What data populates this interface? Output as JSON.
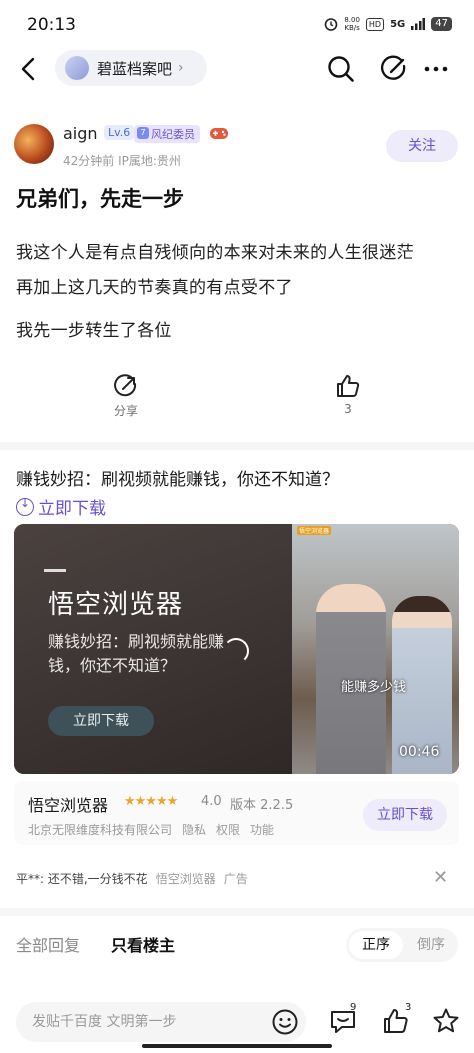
{
  "status": {
    "time": "20:13",
    "net_speed": "8.00\nKB/s",
    "hd": "HD",
    "signal": "5G",
    "battery": "47"
  },
  "topbar": {
    "forum_name": "碧蓝档案吧"
  },
  "author": {
    "name": "aign",
    "level": "Lv.6",
    "badge_num": "7",
    "badge": "风纪委员",
    "meta": "42分钟前  IP属地:贵州",
    "follow": "关注"
  },
  "post": {
    "title": "兄弟们，先走一步",
    "lines": [
      "我这个人是有点自残倾向的本来对未来的人生很迷茫",
      "再加上这几天的节奏真的有点受不了",
      "我先一步转生了各位"
    ]
  },
  "actions": {
    "share": "分享",
    "likes": "3"
  },
  "ad": {
    "headline": "赚钱妙招：刷视频就能赚钱，你还不知道？",
    "download_link": "立即下载",
    "video": {
      "brand": "悟空浏览器",
      "sub1": "赚钱妙招：刷视频就能赚",
      "sub2": "钱，你还不知道？",
      "button": "立即下载",
      "caption": "能赚多少钱",
      "duration": "00:46",
      "tag": "悟空浏览器"
    },
    "app": {
      "name": "悟空浏览器",
      "stars": "★★★★★",
      "rating": "4.0",
      "version": "版本 2.2.5",
      "company": "北京无限维度科技有限公司",
      "privacy": "隐私",
      "permissions": "权限",
      "features": "功能",
      "download": "立即下载"
    },
    "comment": "平**: 还不错,一分钱不花",
    "app_label": "悟空浏览器",
    "ad_label": "广告"
  },
  "replies": {
    "all": "全部回复",
    "only_op": "只看楼主",
    "sort_asc": "正序",
    "sort_desc": "倒序"
  },
  "bottombar": {
    "placeholder": "发贴千百度 文明第一步",
    "comment_count": "9",
    "like_count": "3"
  },
  "colors": {
    "accent": "#6a4fd3",
    "star": "#f0a230"
  }
}
